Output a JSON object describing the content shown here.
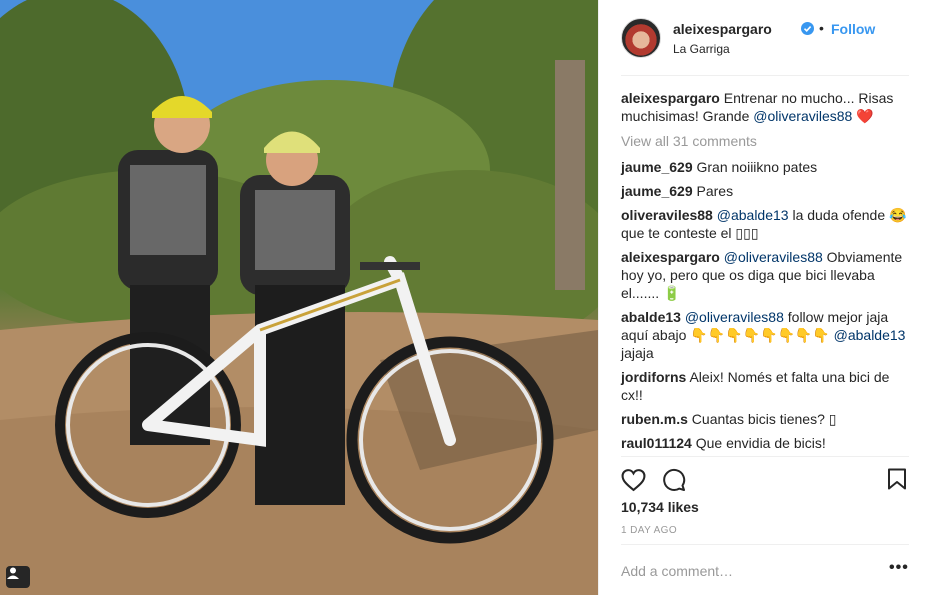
{
  "post": {
    "username": "aleixespargaro",
    "follow_label": "Follow",
    "dot": "•",
    "location": "La Garriga",
    "caption": {
      "user": "aleixespargaro",
      "text": "Entrenar no mucho... Risas muchisimas! Grande ",
      "mention": "@oliveraviles88",
      "emoji": "❤️"
    },
    "view_all": "View all 31 comments",
    "likes": "10,734 likes",
    "time": "1 DAY AGO",
    "add_comment_placeholder": "Add a comment…",
    "more": "•••"
  },
  "comments": [
    {
      "user": "jaume_629",
      "parts": [
        {
          "t": "text",
          "v": "Gran noiiikno pates"
        }
      ]
    },
    {
      "user": "jaume_629",
      "parts": [
        {
          "t": "text",
          "v": "Pares"
        }
      ]
    },
    {
      "user": "oliveraviles88",
      "parts": [
        {
          "t": "mention",
          "v": "@abalde13"
        },
        {
          "t": "text",
          "v": " la duda ofende "
        },
        {
          "t": "text",
          "v": "😂 que te conteste el ▯▯▯"
        }
      ]
    },
    {
      "user": "aleixespargaro",
      "parts": [
        {
          "t": "mention",
          "v": "@oliveraviles88"
        },
        {
          "t": "text",
          "v": " Obviamente hoy yo, pero que os diga que bici llevaba el....... 🔋"
        }
      ]
    },
    {
      "user": "abalde13",
      "parts": [
        {
          "t": "mention",
          "v": "@oliveraviles88"
        },
        {
          "t": "text",
          "v": " follow mejor jaja aquí abajo 👇👇👇👇👇👇👇👇 "
        },
        {
          "t": "mention",
          "v": "@abalde13"
        },
        {
          "t": "text",
          "v": " jajaja"
        }
      ]
    },
    {
      "user": "jordiforns",
      "parts": [
        {
          "t": "text",
          "v": "Aleix! Només et falta una bici de cx!!"
        }
      ]
    },
    {
      "user": "ruben.m.s",
      "parts": [
        {
          "t": "text",
          "v": "Cuantas bicis tienes? ▯"
        }
      ]
    },
    {
      "user": "raul011124",
      "parts": [
        {
          "t": "text",
          "v": "Que envidia de bicis!"
        }
      ]
    }
  ],
  "icons": {
    "heart": "heart-icon",
    "comment": "comment-icon",
    "bookmark": "bookmark-icon",
    "verified": "verified-badge-icon",
    "tag": "user-tag-icon"
  },
  "colors": {
    "link": "#3897f0",
    "mention": "#003569",
    "muted": "#999999",
    "text": "#262626"
  }
}
